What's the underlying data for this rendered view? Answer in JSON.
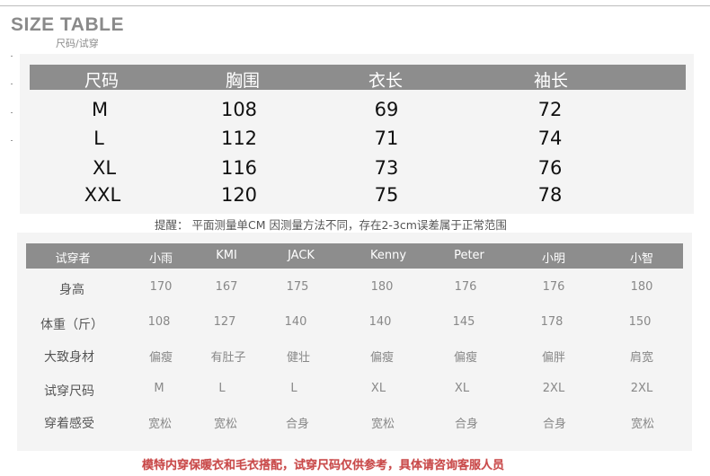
{
  "header": {
    "title": "SIZE TABLE",
    "subtitle": "尺码/试穿"
  },
  "size_table": {
    "columns": [
      "尺码",
      "胸围",
      "衣长",
      "袖长"
    ],
    "rows": [
      [
        "M",
        "108",
        "69",
        "72"
      ],
      [
        "L",
        "112",
        "71",
        "74"
      ],
      [
        "XL",
        "116",
        "73",
        "76"
      ],
      [
        "XXL",
        "120",
        "75",
        "78"
      ]
    ]
  },
  "note": "提醒： 平面测量单CM 因测量方法不同，存在2-3cm误差属于正常范围",
  "tryon_table": {
    "columns": [
      "试穿者",
      "小雨",
      "KMI",
      "JACK",
      "Kenny",
      "Peter",
      "小明",
      "小智"
    ],
    "rows": [
      [
        "身高",
        "170",
        "167",
        "175",
        "180",
        "176",
        "176",
        "180"
      ],
      [
        "体重（斤）",
        "108",
        "127",
        "140",
        "140",
        "145",
        "178",
        "150"
      ],
      [
        "大致身材",
        "偏瘦",
        "有肚子",
        "健壮",
        "偏瘦",
        "偏瘦",
        "偏胖",
        "肩宽"
      ],
      [
        "试穿尺码",
        "M",
        "L",
        "L",
        "XL",
        "XL",
        "2XL",
        "2XL"
      ],
      [
        "穿着感受",
        "宽松",
        "宽松",
        "合身",
        "宽松",
        "合身",
        "合身",
        "宽松"
      ]
    ]
  },
  "footer": "模特内穿保暖衣和毛衣搭配，试穿尺码仅供参考，具体请咨询客服人员"
}
